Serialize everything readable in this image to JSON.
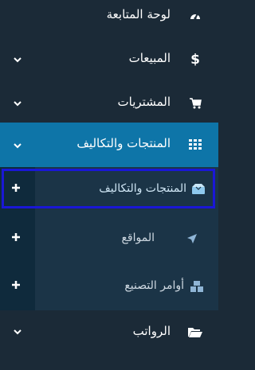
{
  "menu": {
    "dashboard": {
      "label": "لوحة المتابعة",
      "icon": "speedometer-icon"
    },
    "sales": {
      "label": "المبيعات",
      "icon": "dollar-icon"
    },
    "purchases": {
      "label": "المشتريات",
      "icon": "cart-icon"
    },
    "products_costs": {
      "label": "المنتجات والتكاليف",
      "icon": "grid-icon"
    },
    "salaries": {
      "label": "الرواتب",
      "icon": "folder-open-icon"
    }
  },
  "submenu": {
    "products_costs_item": {
      "label": "المنتجات والتكاليف",
      "icon": "boxes-icon"
    },
    "locations": {
      "label": "المواقع",
      "icon": "location-arrow-icon"
    },
    "manufacturing_orders": {
      "label": "أوامر التصنيع",
      "icon": "cubes-icon"
    }
  },
  "colors": {
    "sidebar_bg": "#1b2a37",
    "active_parent_bg": "#0e75a8",
    "submenu_bg": "#1b3447",
    "plus_column_bg": "#0f2a3c",
    "selection_border": "#1a17d6",
    "submenu_text": "#cfd9e2"
  }
}
